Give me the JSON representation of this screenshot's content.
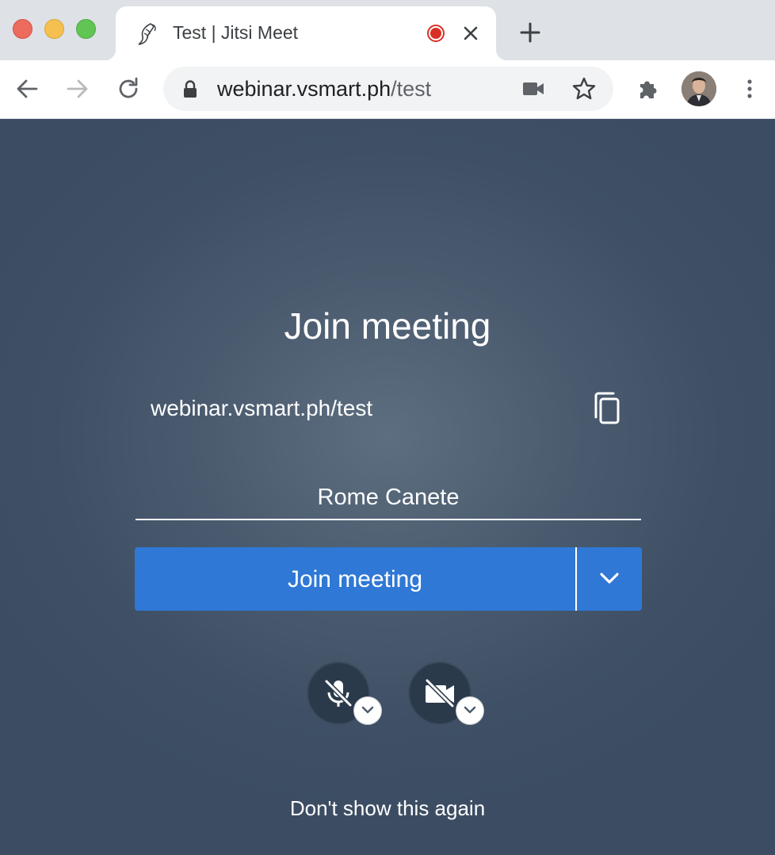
{
  "browser": {
    "tab": {
      "title": "Test | Jitsi Meet",
      "favicon": "jitsi-logo-icon",
      "recording_indicator": "recording-dot-icon"
    },
    "url": {
      "host": "webinar.vsmart.ph",
      "path": "/test"
    },
    "icons": [
      "back-arrow-icon",
      "forward-arrow-icon",
      "reload-icon",
      "lock-icon",
      "camera-icon",
      "star-icon",
      "extensions-puzzle-icon",
      "profile-avatar",
      "more-vert-icon",
      "new-tab-plus-icon",
      "close-icon"
    ]
  },
  "prejoin": {
    "title": "Join meeting",
    "meeting_url": "webinar.vsmart.ph/test",
    "name_value": "Rome Canete",
    "join_button": "Join meeting",
    "dont_show": "Don't show this again",
    "mic_state": "muted",
    "camera_state": "off"
  },
  "colors": {
    "accent": "#2f78d5",
    "background": "#4a5a6e",
    "recording": "#d93025"
  }
}
